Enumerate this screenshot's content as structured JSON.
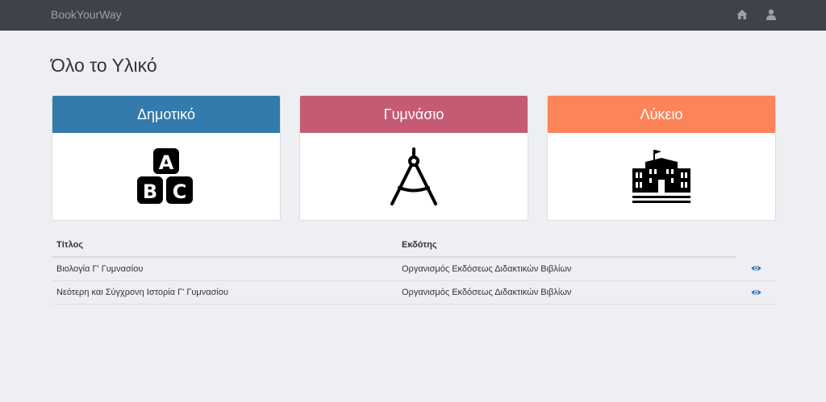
{
  "navbar": {
    "brand": "BookYourWay",
    "home_icon": "home-icon",
    "user_icon": "user-icon"
  },
  "page": {
    "title": "Όλο το Υλικό"
  },
  "categories": [
    {
      "label": "Δημοτικό",
      "icon": "abc-blocks-icon",
      "color": "#337aad"
    },
    {
      "label": "Γυμνάσιο",
      "icon": "compass-icon",
      "color": "#c45b73"
    },
    {
      "label": "Λύκειο",
      "icon": "school-building-icon",
      "color": "#fb8459"
    }
  ],
  "table": {
    "headers": [
      "Τίτλος",
      "Εκδότης"
    ],
    "rows": [
      {
        "title": "Βιολογία Γ' Γυμνασίου",
        "publisher": "Οργανισμός Εκδόσεως Διδακτικών Βιβλίων",
        "action_icon": "eye-icon"
      },
      {
        "title": "Νεότερη και Σύγχρονη Ιστορία Γ' Γυμνασίου",
        "publisher": "Οργανισμός Εκδόσεως Διδακτικών Βιβλίων",
        "action_icon": "eye-icon"
      }
    ]
  },
  "colors": {
    "navbar": "#3e434b",
    "background": "#eeeff2",
    "link": "#337ab7"
  }
}
